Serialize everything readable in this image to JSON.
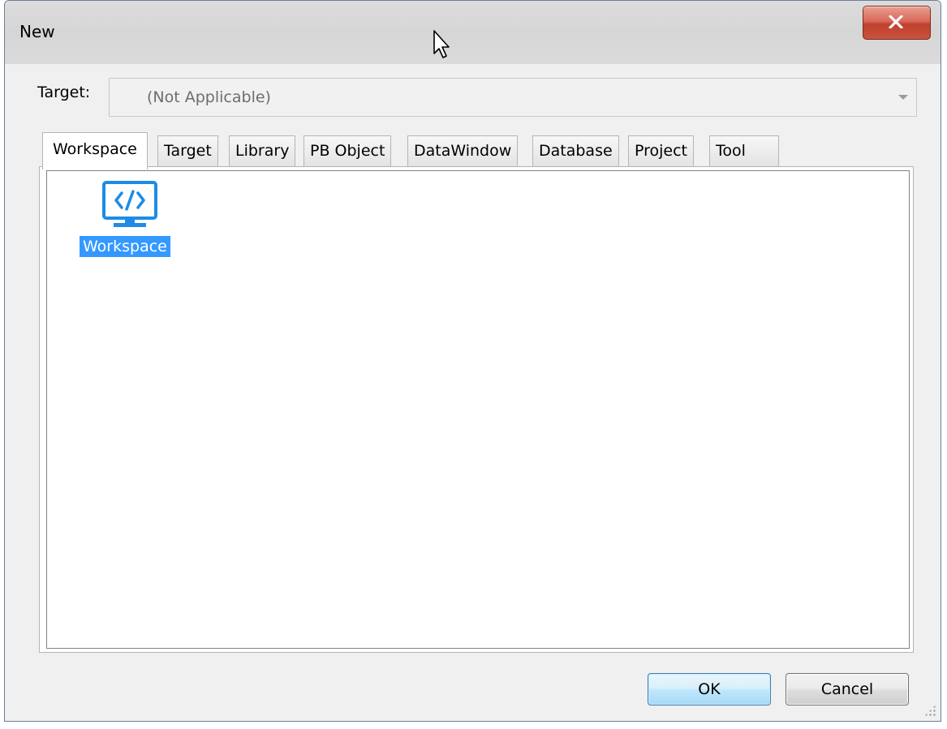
{
  "window": {
    "title": "New",
    "close_label": "Close"
  },
  "target": {
    "label": "Target:",
    "value": "(Not Applicable)"
  },
  "tabs": [
    {
      "label": "Workspace",
      "active": true
    },
    {
      "label": "Target",
      "active": false
    },
    {
      "label": "Library",
      "active": false
    },
    {
      "label": "PB Object",
      "active": false
    },
    {
      "label": "DataWindow",
      "active": false
    },
    {
      "label": "Database",
      "active": false
    },
    {
      "label": "Project",
      "active": false
    },
    {
      "label": "Tool",
      "active": false
    }
  ],
  "panel": {
    "items": [
      {
        "label": "Workspace",
        "icon": "workspace-monitor-code-icon",
        "selected": true
      }
    ]
  },
  "buttons": {
    "ok_label": "OK",
    "cancel_label": "Cancel"
  },
  "colors": {
    "selection": "#3399ff",
    "icon": "#1e8ce6",
    "close_button": "#c8533f"
  }
}
